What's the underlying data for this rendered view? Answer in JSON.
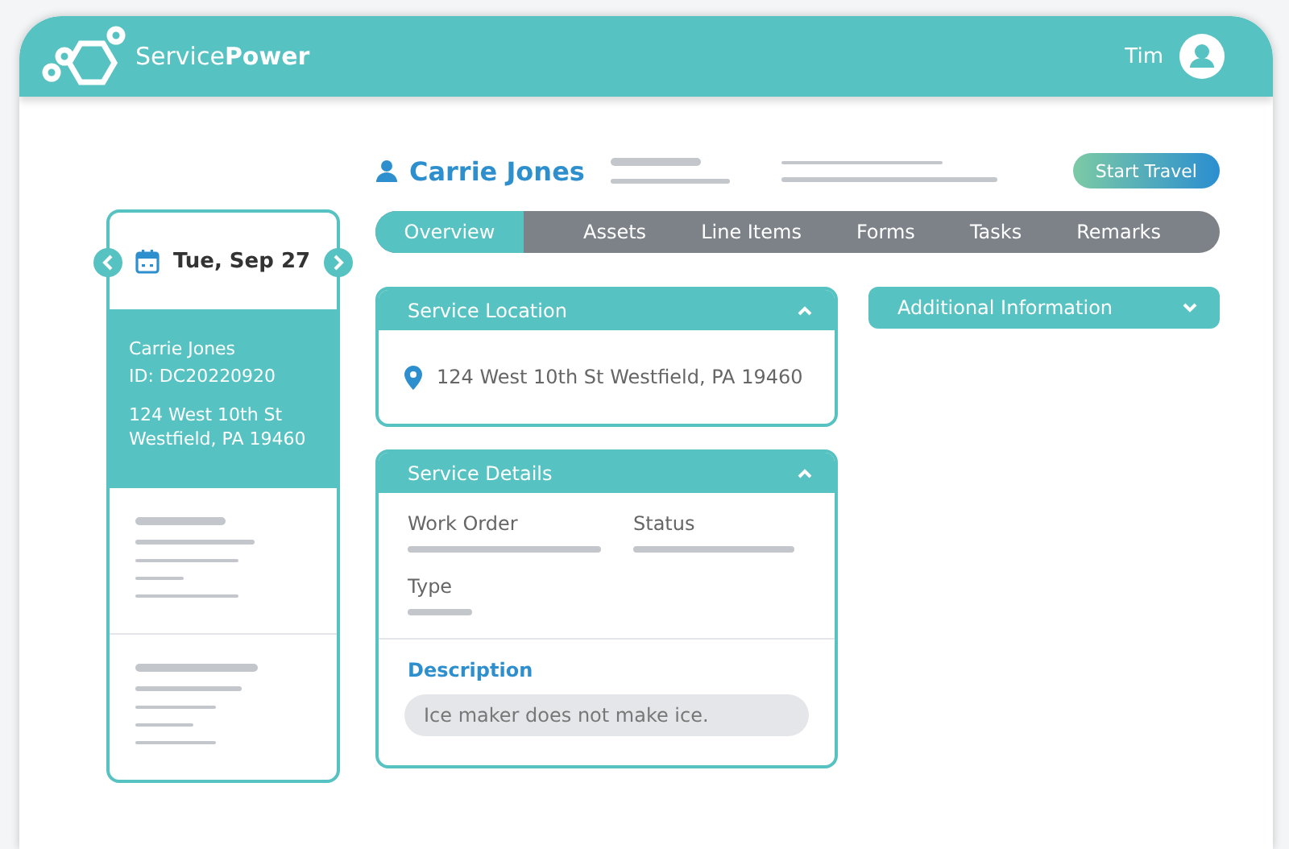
{
  "header": {
    "logo": "Service**Power**",
    "user": "Tim"
  },
  "customer": {
    "name": "Carrie Jones"
  },
  "start_travel": "Start Travel",
  "tabs": [
    {
      "label": "Overview",
      "selected": true
    },
    {
      "label": "Assets",
      "selected": false
    },
    {
      "label": "Line Items",
      "selected": false
    },
    {
      "label": "Forms",
      "selected": false
    },
    {
      "label": "Tasks",
      "selected": false
    },
    {
      "label": "Remarks",
      "selected": false
    }
  ],
  "schedule": {
    "date": "Tue, Sep 27",
    "appointments": [
      {
        "name": "Carrie Jones",
        "id": "ID: DC20220920",
        "address": [
          "124 West 10th St",
          "Westfield, PA 19460"
        ],
        "selected": true
      }
    ]
  },
  "service_location": {
    "title": "Service Location",
    "expanded": true,
    "address": "124 West 10th St Westfield, PA 19460"
  },
  "service_details": {
    "title": "Service Details",
    "expanded": true,
    "fields": [
      "Work Order",
      "Status",
      "Type"
    ],
    "description_label": "Description",
    "description": "Ice maker does not make ice."
  },
  "additional_information": {
    "title": "Additional Information",
    "expanded": false
  }
}
